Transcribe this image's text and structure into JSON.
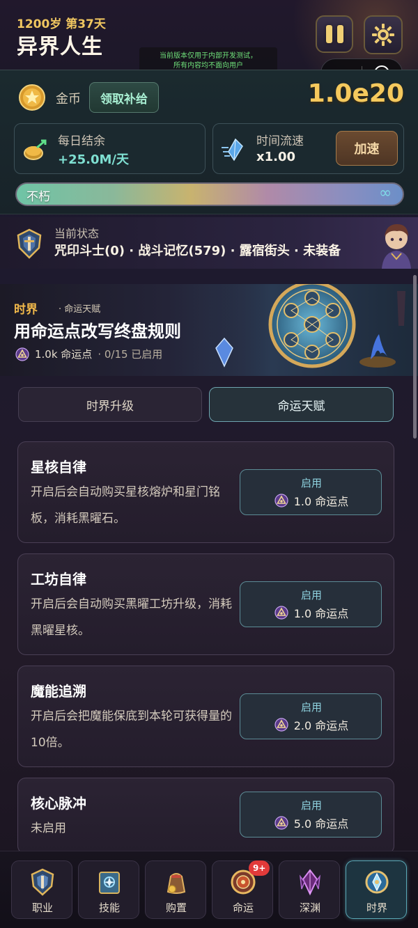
{
  "header": {
    "age": "1200岁 第37天",
    "title": "异界人生",
    "notice_line1": "当前版本仅用于内部开发测试，",
    "notice_line2": "所有内容均不面向用户"
  },
  "resources": {
    "coin_label": "金币",
    "claim_label": "领取补给",
    "coin_value": "1.0e20",
    "daily_label": "每日结余",
    "daily_value": "+25.0M/天",
    "speed_label": "时间流速",
    "speed_value": "x1.00",
    "accelerate_label": "加速",
    "life_label": "不朽",
    "life_symbol": "∞"
  },
  "status": {
    "label": "当前状态",
    "value": "咒印斗士(0) · 战斗记忆(579) · 露宿街头 · 未装备"
  },
  "banner": {
    "tag_main": "时界",
    "tag_sub": "· 命运天赋",
    "title": "用命运点改写终盘规则",
    "points": "1.0k 命运点",
    "enabled": "· 0/15 已启用"
  },
  "tabs": [
    {
      "label": "时界升级",
      "active": false
    },
    {
      "label": "命运天赋",
      "active": true
    }
  ],
  "talents": [
    {
      "name": "星核自律",
      "desc": "开启后会自动购买星核熔炉和星门铭板，消耗黑曜石。",
      "action": "启用",
      "cost": "1.0 命运点"
    },
    {
      "name": "工坊自律",
      "desc": "开启后会自动购买黑曜工坊升级，消耗黑曜星核。",
      "action": "启用",
      "cost": "1.0 命运点"
    },
    {
      "name": "魔能追溯",
      "desc": "开启后会把魔能保底到本轮可获得量的 10倍。",
      "action": "启用",
      "cost": "2.0 命运点"
    },
    {
      "name": "核心脉冲",
      "desc": "未启用",
      "action": "启用",
      "cost": "5.0 命运点"
    }
  ],
  "nav": [
    {
      "label": "职业",
      "icon": "shield-icon",
      "active": false
    },
    {
      "label": "技能",
      "icon": "spellbook-icon",
      "active": false
    },
    {
      "label": "购置",
      "icon": "bag-icon",
      "active": false
    },
    {
      "label": "命运",
      "icon": "fate-wheel-icon",
      "active": false,
      "badge": "9+"
    },
    {
      "label": "深渊",
      "icon": "abyss-crystal-icon",
      "active": false
    },
    {
      "label": "时界",
      "icon": "time-realm-icon",
      "active": true
    }
  ],
  "colors": {
    "gold": "#f5c95d",
    "accent_teal": "#5aa8b6",
    "badge_red": "#e23a3a",
    "notice_green": "#6fe07a"
  }
}
